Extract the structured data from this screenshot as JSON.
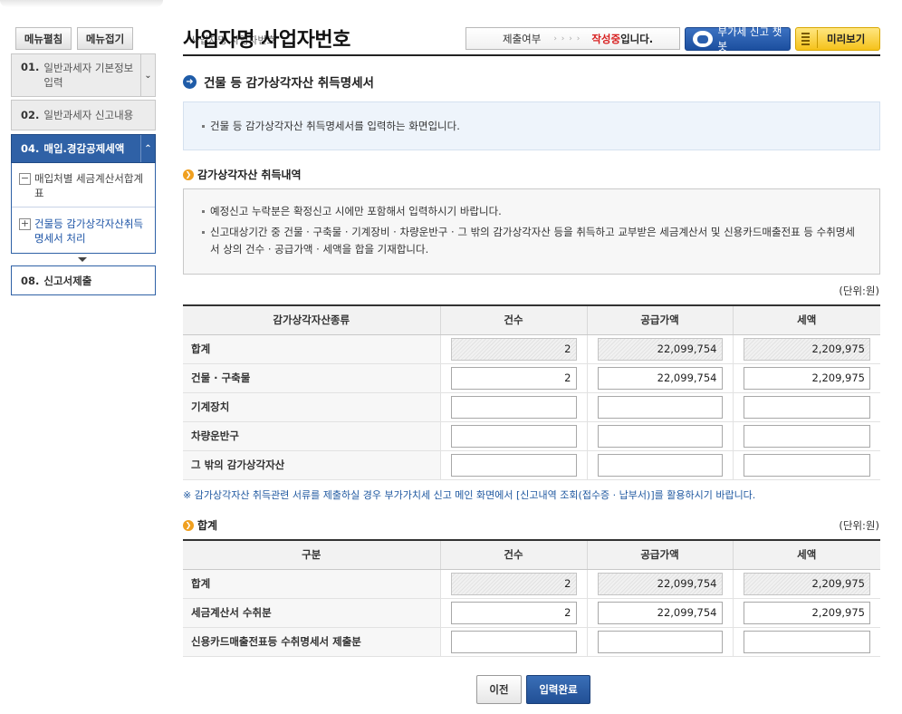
{
  "sidebar": {
    "edit_button": "메뉴펼침",
    "fold_button": "메뉴접기",
    "menu": [
      {
        "num": "01.",
        "label": "일반과세자 기본정보 입력"
      },
      {
        "num": "02.",
        "label": "일반과세자 신고내용"
      },
      {
        "num": "04.",
        "label": "매입.경감공제세액"
      },
      {
        "num": "08.",
        "label": "신고서제출"
      }
    ],
    "sub_items": [
      {
        "label": "매입처별 세금계산서합계표",
        "toggle": "−"
      },
      {
        "label": "건물등 감가상각자산취득명세서 처리",
        "toggle": "+"
      }
    ]
  },
  "header": {
    "title": "사업자명 사업자번호",
    "title_ghost": "사업자명  사업자번호",
    "status_label": "제출여부",
    "status_dots": "› › › ›",
    "status_value": "작성중",
    "status_suffix": "입니다.",
    "chatbot_label": "부가세 신고 챗봇",
    "preview_label": "미리보기"
  },
  "section": {
    "title": "건물 등 감가상각자산 취득명세서",
    "intro": "건물 등 감가상각자산 취득명세서를 입력하는 화면입니다.",
    "sub_title": "감가상각자산 취득내역",
    "notices": [
      "예정신고 누락분은 확정신고 시에만 포함해서 입력하시기 바랍니다.",
      "신고대상기간 중 건물 · 구축물 · 기계장비 · 차량운반구 · 그 밖의 감가상각자산 등을 취득하고 교부받은 세금계산서 및 신용카드매출전표 등 수취명세서 상의 건수 · 공급가액 · 세액을 합을 기재합니다."
    ],
    "unit": "(단위:원)",
    "table1": {
      "headers": [
        "감가상각자산종류",
        "건수",
        "공급가액",
        "세액"
      ],
      "rows": [
        {
          "label": "합계",
          "count": "2",
          "supply": "22,099,754",
          "tax": "2,209,975"
        },
        {
          "label": "건물 · 구축물",
          "count": "2",
          "supply": "22,099,754",
          "tax": "2,209,975"
        },
        {
          "label": "기계장치",
          "count": "",
          "supply": "",
          "tax": ""
        },
        {
          "label": "차량운반구",
          "count": "",
          "supply": "",
          "tax": ""
        },
        {
          "label": "그 밖의 감가상각자산",
          "count": "",
          "supply": "",
          "tax": ""
        }
      ]
    },
    "footnote": "※ 감가상각자산 취득관련 서류를 제출하실 경우 부가가치세 신고 메인 화면에서 [신고내역 조회(접수증 · 납부서)]를 활용하시기 바랍니다.",
    "sum_title": "합계",
    "table2": {
      "headers": [
        "구분",
        "건수",
        "공급가액",
        "세액"
      ],
      "rows": [
        {
          "label": "합계",
          "count": "2",
          "supply": "22,099,754",
          "tax": "2,209,975"
        },
        {
          "label": "세금계산서 수취분",
          "count": "2",
          "supply": "22,099,754",
          "tax": "2,209,975"
        },
        {
          "label": "신용카드매출전표등 수취명세서 제출분",
          "count": "",
          "supply": "",
          "tax": ""
        }
      ]
    }
  },
  "buttons": {
    "prev": "이전",
    "done": "입력완료"
  },
  "colors": {
    "accent": "#2f61a6",
    "status_red": "#d71f1f",
    "preview_yellow": "#f5c21b"
  }
}
